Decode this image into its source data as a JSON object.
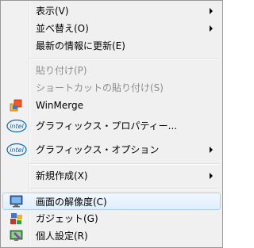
{
  "menu": {
    "items": [
      {
        "label": "表示(V)",
        "submenu": true
      },
      {
        "label": "並べ替え(O)",
        "submenu": true
      },
      {
        "label": "最新の情報に更新(E)"
      },
      {
        "label": "貼り付け(P)",
        "disabled": true
      },
      {
        "label": "ショートカットの貼り付け(S)",
        "disabled": true
      },
      {
        "label": "WinMerge",
        "icon": "winmerge-icon"
      },
      {
        "label": "グラフィックス・プロパティー...",
        "icon": "intel-icon"
      },
      {
        "label": "グラフィックス・オプション",
        "icon": "intel-icon",
        "submenu": true
      },
      {
        "label": "新規作成(X)",
        "submenu": true
      },
      {
        "label": "画面の解像度(C)",
        "icon": "display-icon",
        "highlighted": true
      },
      {
        "label": "ガジェット(G)",
        "icon": "gadget-icon"
      },
      {
        "label": "個人設定(R)",
        "icon": "personalize-icon"
      }
    ]
  },
  "colors": {
    "highlight_border": "#aecff7",
    "intel_blue": "#0068b5",
    "disabled_text": "#8d8d8d"
  }
}
